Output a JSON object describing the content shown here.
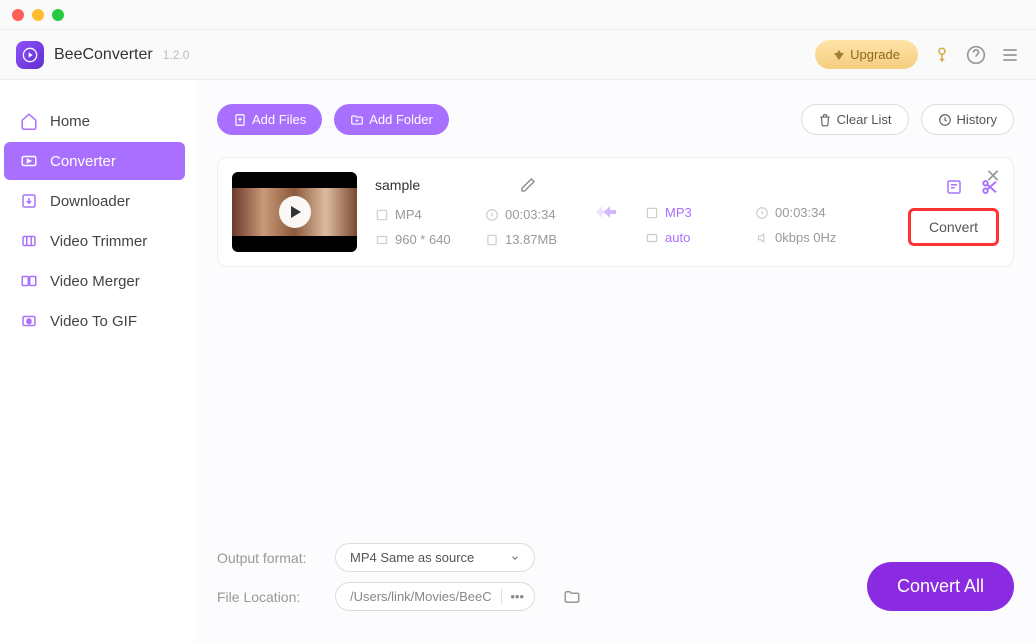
{
  "app": {
    "name": "BeeConverter",
    "version": "1.2.0"
  },
  "header": {
    "upgrade": "Upgrade"
  },
  "sidebar": {
    "items": [
      {
        "label": "Home"
      },
      {
        "label": "Converter"
      },
      {
        "label": "Downloader"
      },
      {
        "label": "Video Trimmer"
      },
      {
        "label": "Video Merger"
      },
      {
        "label": "Video To GIF"
      }
    ]
  },
  "toolbar": {
    "addFiles": "Add Files",
    "addFolder": "Add Folder",
    "clearList": "Clear List",
    "history": "History"
  },
  "file": {
    "name": "sample",
    "format": "MP4",
    "duration": "00:03:34",
    "resolution": "960 * 640",
    "size": "13.87MB"
  },
  "output": {
    "format": "MP3",
    "duration": "00:03:34",
    "resolution": "auto",
    "audio": "0kbps 0Hz"
  },
  "convertBtn": "Convert",
  "settings": {
    "outputFormatLabel": "Output format:",
    "outputFormatValue": "MP4 Same as source",
    "fileLocationLabel": "File Location:",
    "fileLocationValue": "/Users/link/Movies/BeeC"
  },
  "convertAll": "Convert All"
}
